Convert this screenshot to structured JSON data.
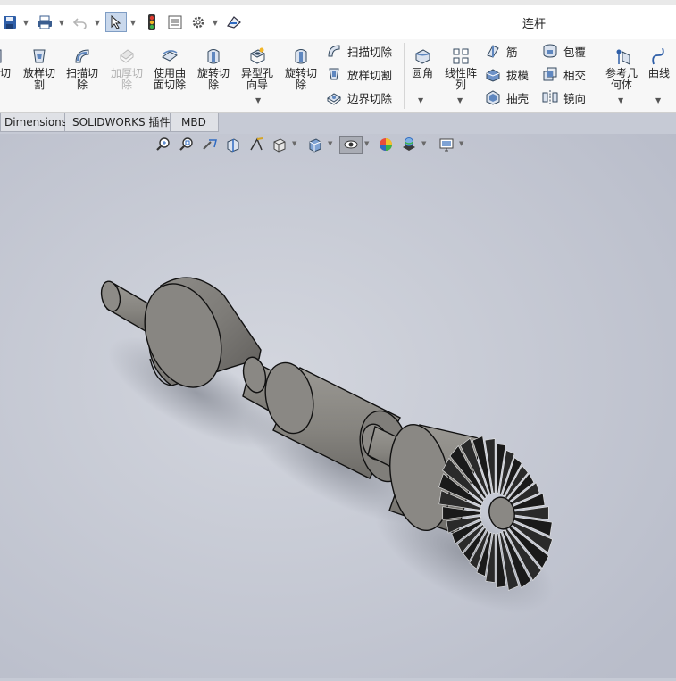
{
  "app": {
    "document_title": "连杆"
  },
  "quick_access": {
    "icons": [
      "save-icon",
      "print-icon",
      "undo-icon",
      "select-icon",
      "traffic-light-icon",
      "file-properties-icon",
      "options-icon",
      "rebuild-icon"
    ]
  },
  "ribbon": {
    "big_buttons": [
      {
        "label": "切\n",
        "icon": "cut-icon",
        "enabled": true
      },
      {
        "label": "放样切\n割",
        "icon": "loft-cut-icon",
        "enabled": true
      },
      {
        "label": "扫描切\n除",
        "icon": "sweep-cut-icon",
        "enabled": true
      },
      {
        "label": "加厚切\n除",
        "icon": "thicken-cut-icon",
        "enabled": false
      },
      {
        "label": "使用曲\n面切除",
        "icon": "surface-cut-icon",
        "enabled": true
      },
      {
        "label": "旋转切\n除",
        "icon": "revolve-cut-icon",
        "enabled": true
      },
      {
        "label": "异型孔\n向导",
        "icon": "hole-wizard-icon",
        "enabled": true
      },
      {
        "label": "旋转切\n除",
        "icon": "revolve-cut-icon",
        "enabled": true
      }
    ],
    "small_group_a": [
      {
        "label": "扫描切除",
        "icon": "sweep-cut-icon"
      },
      {
        "label": "放样切割",
        "icon": "loft-cut-icon"
      },
      {
        "label": "边界切除",
        "icon": "boundary-cut-icon"
      }
    ],
    "fillet": {
      "label": "圆角",
      "icon": "fillet-icon"
    },
    "linear_pattern": {
      "label": "线性阵\n列",
      "icon": "linear-pattern-icon"
    },
    "small_group_b": [
      {
        "label": "筋",
        "icon": "rib-icon"
      },
      {
        "label": "拔模",
        "icon": "draft-icon"
      },
      {
        "label": "抽壳",
        "icon": "shell-icon"
      }
    ],
    "small_group_c": [
      {
        "label": "包覆",
        "icon": "wrap-icon"
      },
      {
        "label": "相交",
        "icon": "intersect-icon"
      },
      {
        "label": "镜向",
        "icon": "mirror-icon"
      }
    ],
    "ref_geometry": {
      "label": "参考几\n何体",
      "icon": "reference-geometry-icon"
    },
    "curves": {
      "label": "曲线",
      "icon": "curves-icon"
    }
  },
  "tabs": [
    "Dimensions",
    "SOLIDWORKS 插件",
    "MBD"
  ],
  "view_toolbar": {
    "icons": [
      "zoom-to-fit-icon",
      "zoom-to-area-icon",
      "previous-view-icon",
      "section-view-icon",
      "dynamic-annotation-icon",
      "view-orientation-icon",
      "display-style-icon",
      "hide-show-items-icon",
      "edit-appearance-icon",
      "apply-scene-icon",
      "view-settings-icon"
    ]
  },
  "colors": {
    "viewport_bg": "#c6cad5",
    "part_gray": "#8d8b88",
    "blade_black": "#1a1a1a"
  }
}
